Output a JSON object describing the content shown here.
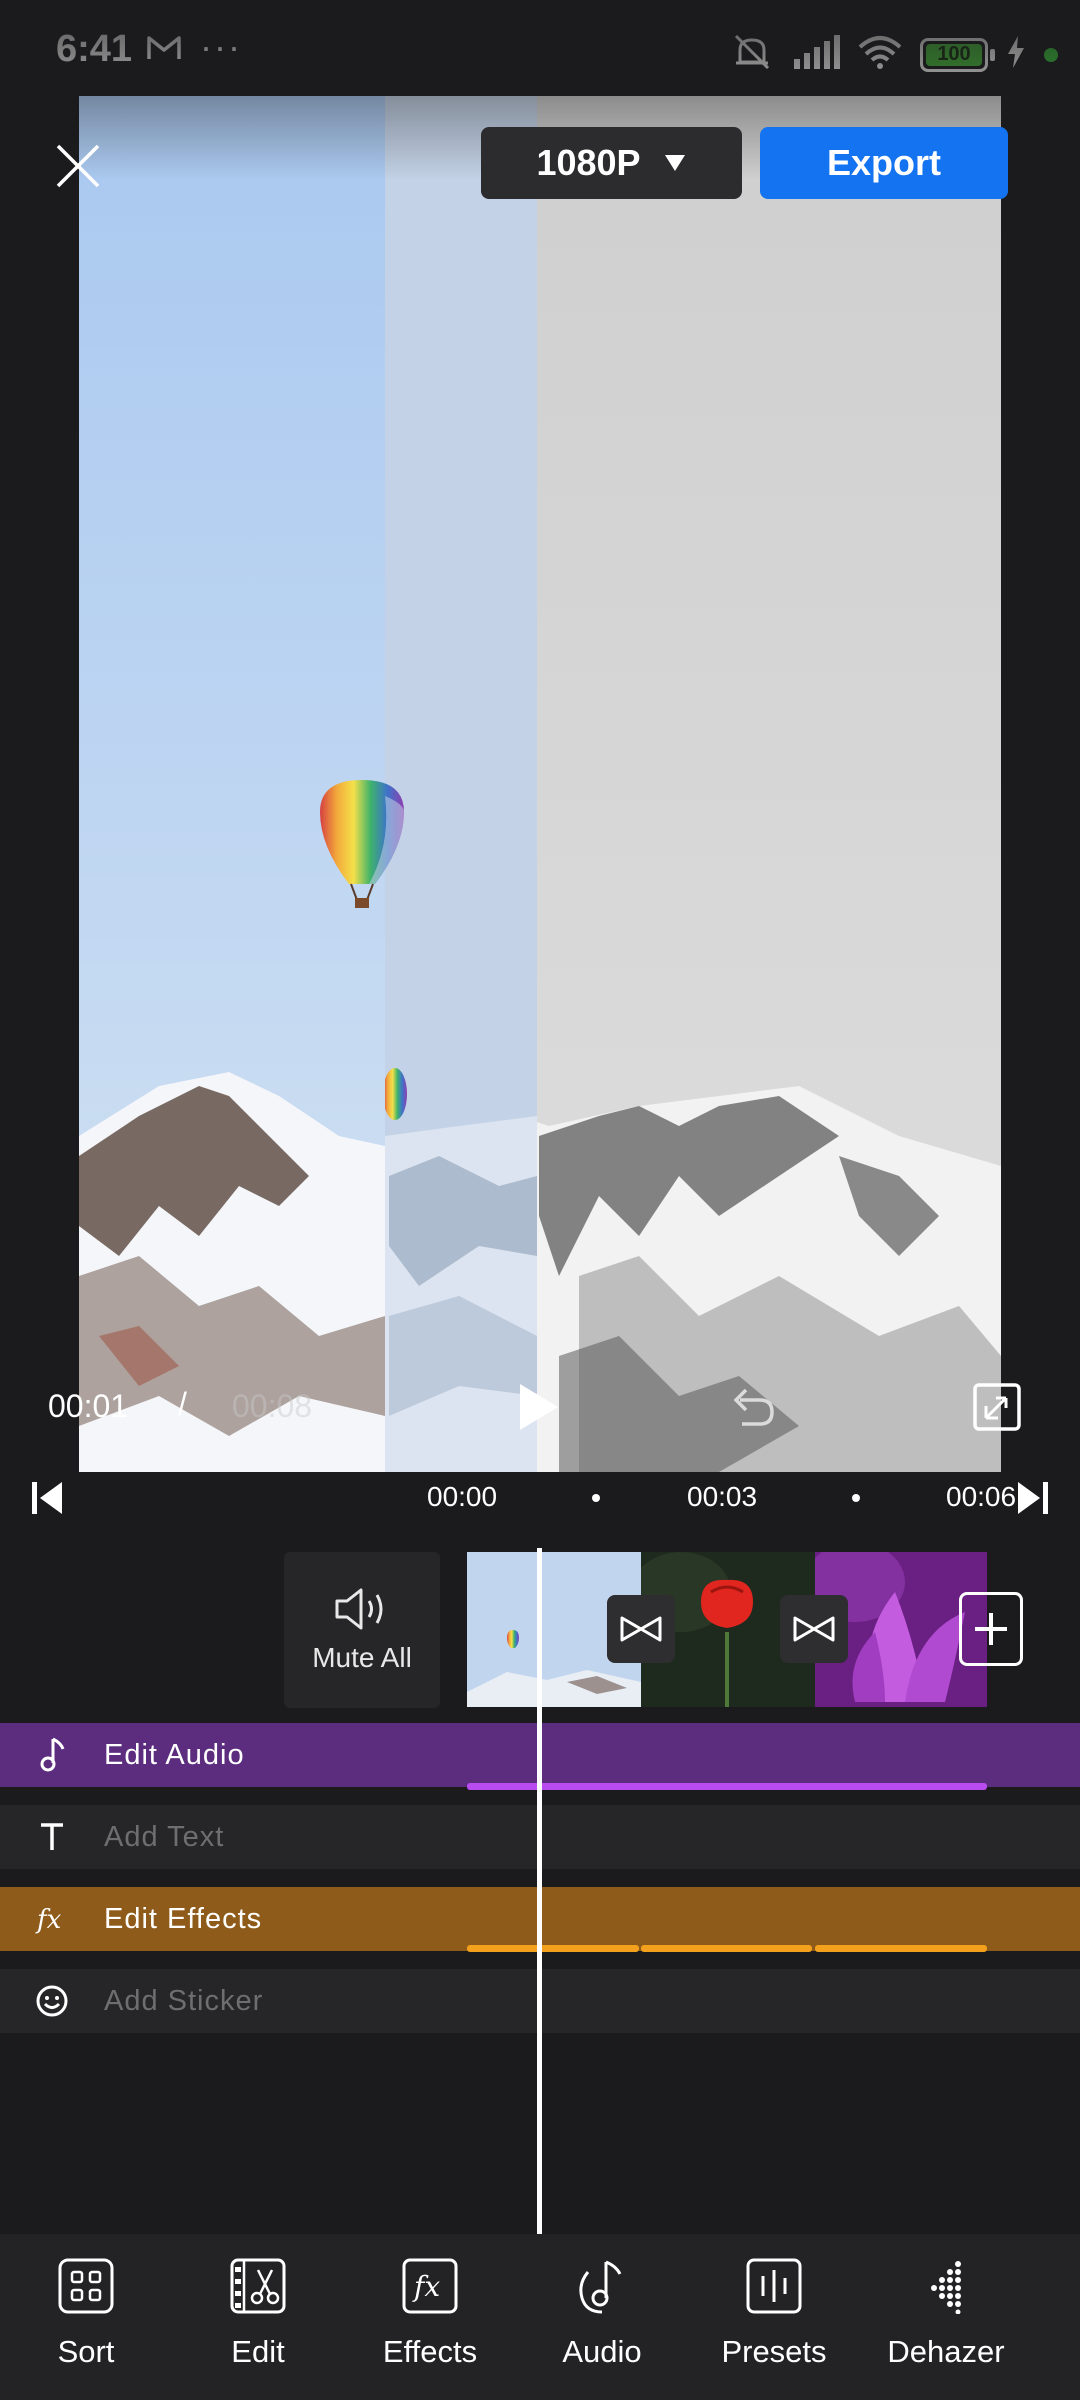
{
  "status_bar": {
    "time": "6:41",
    "more": "···",
    "battery": "100",
    "icons": [
      "gmail-icon",
      "mute-icon",
      "signal-icon",
      "wifi-icon",
      "battery-icon",
      "charging-icon",
      "dot-icon"
    ]
  },
  "header": {
    "resolution": "1080P",
    "export_label": "Export"
  },
  "playback": {
    "current_time": "00:01",
    "separator": "/",
    "total_time": "00:08"
  },
  "ruler": {
    "marks": [
      "00:00",
      "00:03",
      "00:06"
    ]
  },
  "timeline": {
    "mute_all_label": "Mute All",
    "clips": [
      "balloon-mountain",
      "red-poppy",
      "purple-flower"
    ]
  },
  "tracks": {
    "audio": "Edit Audio",
    "text": "Add Text",
    "effects": "Edit Effects",
    "sticker": "Add Sticker"
  },
  "bottom_nav": {
    "items": [
      {
        "label": "Sort",
        "icon": "grid-icon"
      },
      {
        "label": "Edit",
        "icon": "film-scissors-icon"
      },
      {
        "label": "Effects",
        "icon": "fx-icon"
      },
      {
        "label": "Audio",
        "icon": "music-note-icon"
      },
      {
        "label": "Presets",
        "icon": "sliders-icon"
      },
      {
        "label": "Dehazer",
        "icon": "dehaze-icon"
      }
    ]
  },
  "colors": {
    "accent_export": "#1473f0",
    "audio_track": "#5c2d7e",
    "effects_track": "#8e5b1b",
    "background": "#1b1b1d"
  }
}
